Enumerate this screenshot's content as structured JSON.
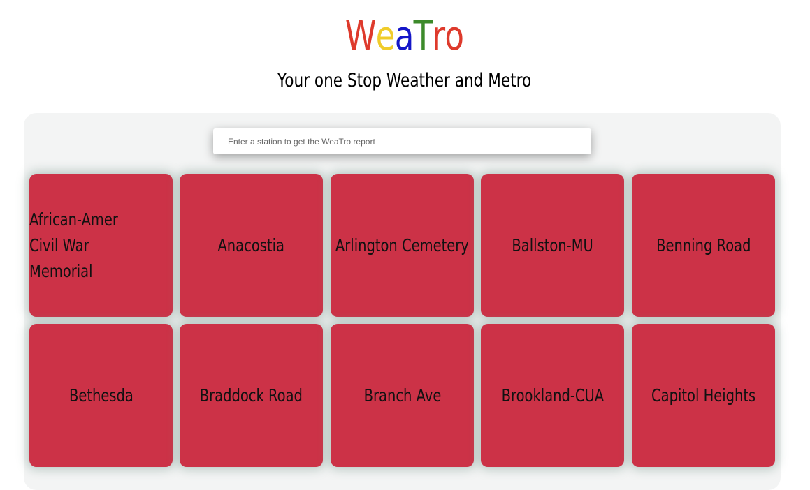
{
  "header": {
    "logo_letters": [
      {
        "char": "W",
        "color": "#de3a2c"
      },
      {
        "char": "e",
        "color": "#f0cc2a"
      },
      {
        "char": "a",
        "color": "#1416c8"
      },
      {
        "char": "T",
        "color": "#3c8a2a"
      },
      {
        "char": "r",
        "color": "#de3a2c"
      },
      {
        "char": "o",
        "color": "#de3a2c"
      }
    ],
    "tagline": "Your one Stop Weather and Metro"
  },
  "search": {
    "placeholder": "Enter a station to get the WeaTro report",
    "value": ""
  },
  "stations": [
    {
      "name": "African-Amer Civil War Memorial"
    },
    {
      "name": "Anacostia"
    },
    {
      "name": "Arlington Cemetery"
    },
    {
      "name": "Ballston-MU"
    },
    {
      "name": "Benning Road"
    },
    {
      "name": "Bethesda"
    },
    {
      "name": "Braddock Road"
    },
    {
      "name": "Branch Ave"
    },
    {
      "name": "Brookland-CUA"
    },
    {
      "name": "Capitol Heights"
    }
  ],
  "colors": {
    "tile": "#cc3247",
    "panel": "#f3f4f4"
  }
}
